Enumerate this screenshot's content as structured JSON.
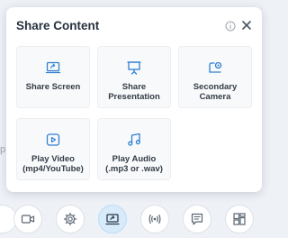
{
  "background": {
    "fragment_text": "p"
  },
  "dialog": {
    "title": "Share Content",
    "options": [
      {
        "label": "Share Screen",
        "icon": "screen-share-icon"
      },
      {
        "label": "Share\nPresentation",
        "icon": "presentation-icon"
      },
      {
        "label": "Secondary\nCamera",
        "icon": "camera-cast-icon"
      },
      {
        "label": "Play Video\n(mp4/YouTube)",
        "icon": "play-video-icon"
      },
      {
        "label": "Play Audio\n(.mp3 or .wav)",
        "icon": "music-note-icon"
      }
    ]
  },
  "toolbar": {
    "items": [
      {
        "icon": "partial-button-icon"
      },
      {
        "icon": "video-camera-icon"
      },
      {
        "icon": "gear-icon"
      },
      {
        "icon": "share-screen-icon",
        "active": true
      },
      {
        "icon": "broadcast-icon"
      },
      {
        "icon": "chat-icon"
      },
      {
        "icon": "layout-icon"
      }
    ]
  },
  "colors": {
    "accent": "#2f80d1",
    "active_bg": "#d8ebfb",
    "title": "#26313e",
    "icon_gray": "#5b6672"
  }
}
